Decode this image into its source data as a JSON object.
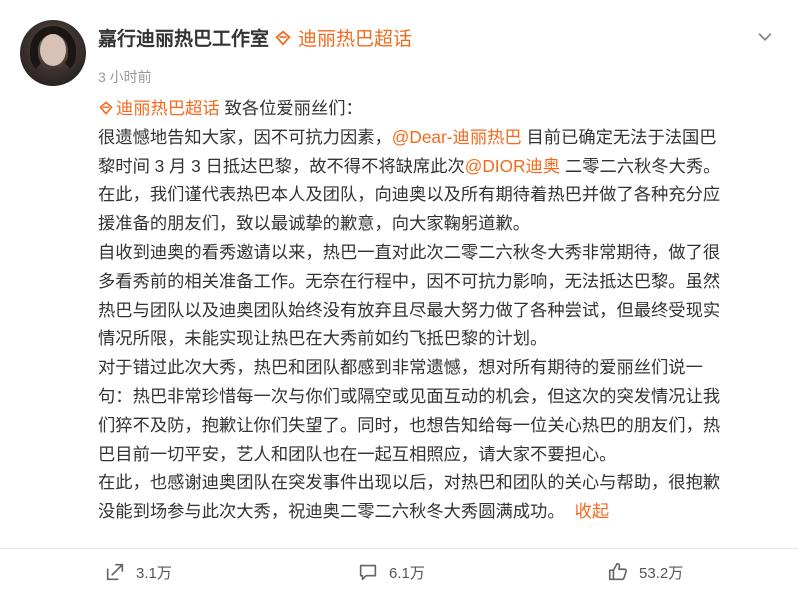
{
  "author": {
    "name": "嘉行迪丽热巴工作室",
    "topic_badge": "迪丽热巴超话",
    "timestamp": "3 小时前"
  },
  "post": {
    "topic_tag": "迪丽热巴超话",
    "greeting": " 致各位爱丽丝们：",
    "mention_artist": "@Dear-迪丽热巴",
    "mention_brand": "@DIOR迪奥",
    "line1_a": "很遗憾地告知大家，因不可抗力因素，",
    "line1_b": " 目前已确定无法于法国巴",
    "line2_a": "黎时间 3 月 3 日抵达巴黎，故不得不将缺席此次",
    "line2_b": " 二零二六秋冬大秀。",
    "line3": "在此，我们谨代表热巴本人及团队，向迪奥以及所有期待着热巴并做了各种充分应",
    "line4": "援准备的朋友们，致以最诚挚的歉意，向大家鞠躬道歉。",
    "line5": "自收到迪奥的看秀邀请以来，热巴一直对此次二零二六秋冬大秀非常期待，做了很",
    "line6": "多看秀前的相关准备工作。无奈在行程中，因不可抗力影响，无法抵达巴黎。虽然",
    "line7": "热巴与团队以及迪奥团队始终没有放弃且尽最大努力做了各种尝试，但最终受现实",
    "line8": "情况所限，未能实现让热巴在大秀前如约飞抵巴黎的计划。",
    "line9": "对于错过此次大秀，热巴和团队都感到非常遗憾，想对所有期待的爱丽丝们说一",
    "line10": "句：热巴非常珍惜每一次与你们或隔空或见面互动的机会，但这次的突发情况让我",
    "line11": "们猝不及防，抱歉让你们失望了。同时，也想告知给每一位关心热巴的朋友们，热",
    "line12": "巴目前一切平安，艺人和团队也在一起互相照应，请大家不要担心。",
    "line13": "在此，也感谢迪奥团队在突发事件出现以后，对热巴和团队的关心与帮助，很抱歉",
    "line14": "没能到场参与此次大秀，祝迪奥二零二六秋冬大秀圆满成功。",
    "collapse_label": "收起"
  },
  "actions": {
    "repost_count": "3.1万",
    "comment_count": "6.1万",
    "like_count": "53.2万"
  },
  "colors": {
    "accent": "#f46a1d",
    "text": "#333333",
    "muted": "#999999"
  },
  "icons": [
    "topic-diamond-icon",
    "more-chevron-icon",
    "repost-icon",
    "comment-icon",
    "like-icon"
  ]
}
